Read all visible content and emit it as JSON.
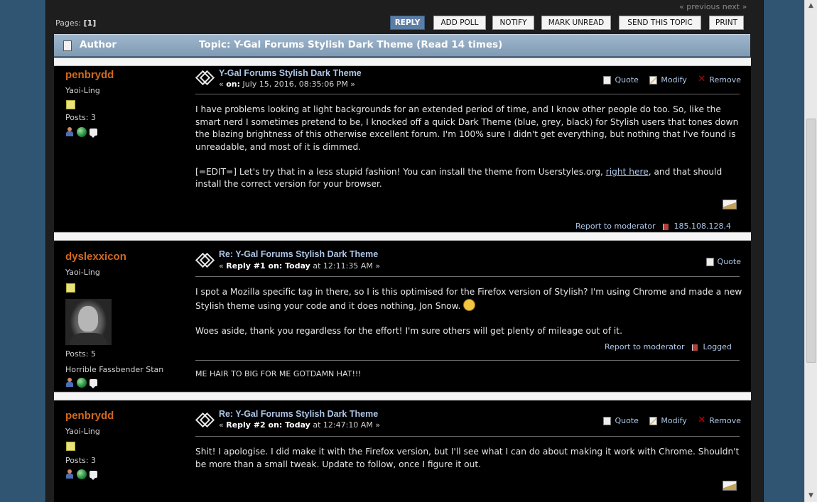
{
  "nav": {
    "prev_next": "« previous next »",
    "pages_label": "Pages:",
    "pages_value": "[1]"
  },
  "toolbar": {
    "reply": "REPLY",
    "add_poll": "ADD POLL",
    "notify": "NOTIFY",
    "mark_unread": "MARK UNREAD",
    "send_topic": "SEND THIS TOPIC",
    "print": "PRINT"
  },
  "header": {
    "author": "Author",
    "topic": "Topic: Y-Gal Forums Stylish Dark Theme  (Read 14 times)"
  },
  "posts": [
    {
      "author": "penbrydd",
      "rank": "Yaoi-Ling",
      "posts": "Posts: 3",
      "subject": "Y-Gal Forums Stylish Dark Theme",
      "date_prefix": "« ",
      "date_label": "on:",
      "date_value": " July 15, 2016, 08:35:06 PM »",
      "actions": [
        "Quote",
        "Modify",
        "Remove"
      ],
      "body_p1": "I have problems looking at light backgrounds for an extended period of time, and I know other people do too. So, like the smart nerd I sometimes pretend to be, I knocked off a quick Dark Theme (blue, grey, black) for Stylish users that tones down the blazing brightness of this otherwise excellent forum. I'm 100% sure I didn't get everything, but nothing that I've found is unreadable, and most of it is dimmed.",
      "body_p2_a": "[=EDIT=] Let's try that in a less stupid fashion! You can install the theme from Userstyles.org, ",
      "body_p2_link": "right here",
      "body_p2_b": ", and that should install the correct version for your browser.",
      "report": "Report to moderator",
      "ip": "185.108.128.4"
    },
    {
      "author": "dyslexxicon",
      "rank": "Yaoi-Ling",
      "posts": "Posts: 5",
      "personal_text": "Horrible Fassbender Stan",
      "subject": "Re: Y-Gal Forums Stylish Dark Theme",
      "date_prefix": "« ",
      "date_label": "Reply #1 on: Today",
      "date_value": " at 12:11:35 AM »",
      "actions": [
        "Quote"
      ],
      "body_p1": "I spot a Mozilla specific tag in there, so I is this optimised for the Firefox version of Stylish? I'm using Chrome and made a new Stylish theme using your code and it does nothing, Jon Snow. ",
      "body_p2": "Woes aside, thank you regardless for the effort! I'm sure others will get plenty of mileage out of it.",
      "report": "Report to moderator",
      "logged": "Logged",
      "signature": "ME HAIR TO BIG FOR ME GOTDAMN HAT!!!"
    },
    {
      "author": "penbrydd",
      "rank": "Yaoi-Ling",
      "posts": "Posts: 3",
      "subject": "Re: Y-Gal Forums Stylish Dark Theme",
      "date_prefix": "« ",
      "date_label": "Reply #2 on: Today",
      "date_value": " at 12:47:10 AM »",
      "actions": [
        "Quote",
        "Modify",
        "Remove"
      ],
      "body_p1": "Shit! I apologise. I did make it with the Firefox version, but I'll see what I can do about making it work with Chrome. Shouldn't be more than a small tweak. Update to follow, once I figure it out."
    }
  ],
  "colors": {
    "author_name": "#d2691e",
    "link": "#aec6e6",
    "post_bg": "#000000",
    "header_bar": "#8aa3ba",
    "reply_button": "#5c7ea6"
  }
}
